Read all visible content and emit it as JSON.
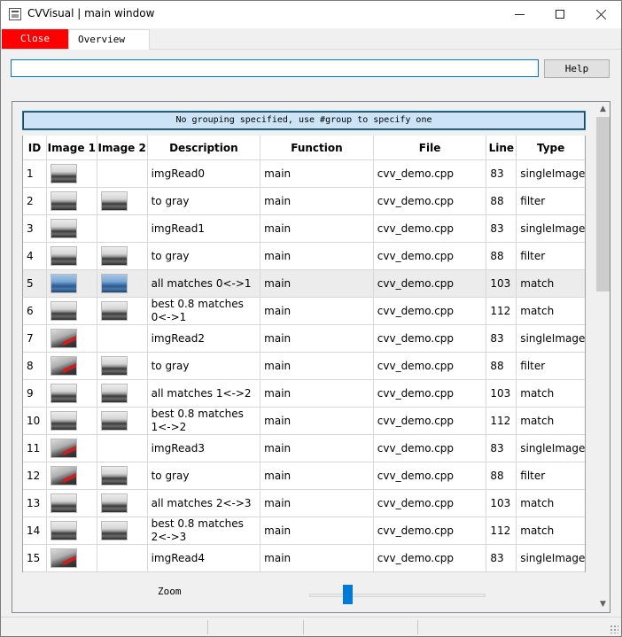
{
  "window": {
    "title": "CVVisual | main window",
    "buttons": {
      "minimize": "—",
      "maximize": "☐",
      "close": "✕"
    }
  },
  "tabs": [
    {
      "label": "Close",
      "color": "#ff0000"
    },
    {
      "label": "Overview",
      "active": true
    }
  ],
  "filter": {
    "value": "",
    "placeholder": ""
  },
  "help_button": {
    "label": "Help"
  },
  "group_header": {
    "text": "No grouping specified, use #group to specify one"
  },
  "table": {
    "columns": [
      "ID",
      "Image 1",
      "Image 2",
      "Description",
      "Function",
      "File",
      "Line",
      "Type"
    ],
    "rows": [
      {
        "id": "1",
        "img1": "gray",
        "img2": "",
        "description": "imgRead0",
        "function": "main",
        "file": "cvv_demo.cpp",
        "line": "83",
        "type": "singleImage"
      },
      {
        "id": "2",
        "img1": "gray",
        "img2": "gray",
        "description": "to gray",
        "function": "main",
        "file": "cvv_demo.cpp",
        "line": "88",
        "type": "filter"
      },
      {
        "id": "3",
        "img1": "gray",
        "img2": "",
        "description": "imgRead1",
        "function": "main",
        "file": "cvv_demo.cpp",
        "line": "83",
        "type": "singleImage"
      },
      {
        "id": "4",
        "img1": "gray",
        "img2": "gray",
        "description": "to gray",
        "function": "main",
        "file": "cvv_demo.cpp",
        "line": "88",
        "type": "filter"
      },
      {
        "id": "5",
        "img1": "blue",
        "img2": "blue",
        "description": "all matches 0<->1",
        "function": "main",
        "file": "cvv_demo.cpp",
        "line": "103",
        "type": "match",
        "selected": true
      },
      {
        "id": "6",
        "img1": "gray",
        "img2": "gray",
        "description": "best 0.8 matches 0<->1",
        "function": "main",
        "file": "cvv_demo.cpp",
        "line": "112",
        "type": "match"
      },
      {
        "id": "7",
        "img1": "red",
        "img2": "",
        "description": "imgRead2",
        "function": "main",
        "file": "cvv_demo.cpp",
        "line": "83",
        "type": "singleImage"
      },
      {
        "id": "8",
        "img1": "red",
        "img2": "gray",
        "description": "to gray",
        "function": "main",
        "file": "cvv_demo.cpp",
        "line": "88",
        "type": "filter"
      },
      {
        "id": "9",
        "img1": "gray",
        "img2": "gray",
        "description": "all matches 1<->2",
        "function": "main",
        "file": "cvv_demo.cpp",
        "line": "103",
        "type": "match"
      },
      {
        "id": "10",
        "img1": "gray",
        "img2": "gray",
        "description": "best 0.8 matches 1<->2",
        "function": "main",
        "file": "cvv_demo.cpp",
        "line": "112",
        "type": "match"
      },
      {
        "id": "11",
        "img1": "red",
        "img2": "",
        "description": "imgRead3",
        "function": "main",
        "file": "cvv_demo.cpp",
        "line": "83",
        "type": "singleImage"
      },
      {
        "id": "12",
        "img1": "red",
        "img2": "gray",
        "description": "to gray",
        "function": "main",
        "file": "cvv_demo.cpp",
        "line": "88",
        "type": "filter"
      },
      {
        "id": "13",
        "img1": "gray",
        "img2": "gray",
        "description": "all matches 2<->3",
        "function": "main",
        "file": "cvv_demo.cpp",
        "line": "103",
        "type": "match"
      },
      {
        "id": "14",
        "img1": "gray",
        "img2": "gray",
        "description": "best 0.8 matches 2<->3",
        "function": "main",
        "file": "cvv_demo.cpp",
        "line": "112",
        "type": "match"
      },
      {
        "id": "15",
        "img1": "red",
        "img2": "",
        "description": "imgRead4",
        "function": "main",
        "file": "cvv_demo.cpp",
        "line": "83",
        "type": "singleImage"
      }
    ]
  },
  "zoom": {
    "label": "Zoom",
    "level": 0.2
  },
  "colors": {
    "accent": "#0078d7",
    "close_tab": "#ff0000",
    "slider": "#007ad9",
    "selected_row": "#ececec"
  }
}
